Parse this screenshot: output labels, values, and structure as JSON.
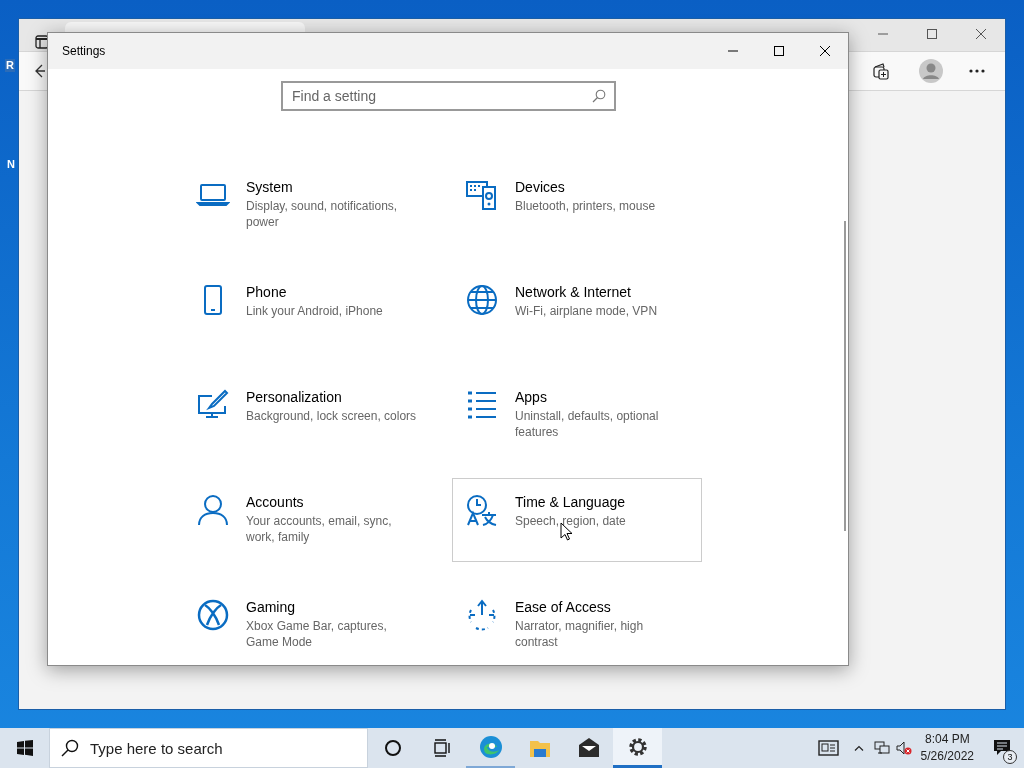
{
  "desktop": {
    "icon_labels": [
      "R",
      "N"
    ]
  },
  "settings_window": {
    "title": "Settings",
    "search": {
      "placeholder": "Find a setting"
    },
    "categories": [
      {
        "title": "System",
        "description": "Display, sound, notifications, power",
        "selected": false
      },
      {
        "title": "Devices",
        "description": "Bluetooth, printers, mouse",
        "selected": false
      },
      {
        "title": "Phone",
        "description": "Link your Android, iPhone",
        "selected": false
      },
      {
        "title": "Network & Internet",
        "description": "Wi-Fi, airplane mode, VPN",
        "selected": false
      },
      {
        "title": "Personalization",
        "description": "Background, lock screen, colors",
        "selected": false
      },
      {
        "title": "Apps",
        "description": "Uninstall, defaults, optional features",
        "selected": false
      },
      {
        "title": "Accounts",
        "description": "Your accounts, email, sync, work, family",
        "selected": false
      },
      {
        "title": "Time & Language",
        "description": "Speech, region, date",
        "selected": true
      },
      {
        "title": "Gaming",
        "description": "Xbox Game Bar, captures, Game Mode",
        "selected": false
      },
      {
        "title": "Ease of Access",
        "description": "Narrator, magnifier, high contrast",
        "selected": false
      }
    ]
  },
  "taskbar": {
    "search": {
      "placeholder": "Type here to search"
    },
    "pinned_apps": [
      {
        "running": true,
        "active": false
      },
      {
        "running": false,
        "active": false
      },
      {
        "running": false,
        "active": false
      },
      {
        "running": true,
        "active": true
      }
    ],
    "clock": {
      "time": "8:04 PM",
      "date": "5/26/2022"
    },
    "notifications": {
      "count": "3"
    }
  }
}
